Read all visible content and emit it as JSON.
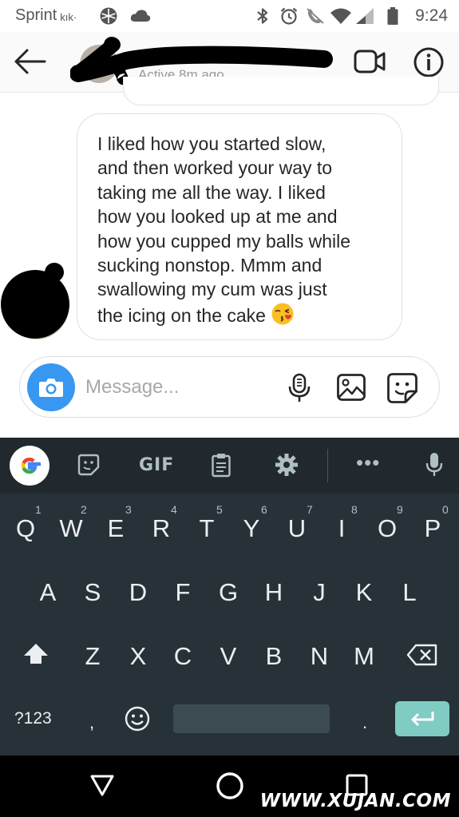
{
  "status_bar": {
    "carrier": "Sprint",
    "kik_label": "kık·",
    "time": "9:24",
    "icons": [
      "ball-icon",
      "cloud-icon",
      "bluetooth-icon",
      "alarm-icon",
      "call-muted-icon",
      "wifi-icon",
      "signal-icon",
      "battery-icon"
    ]
  },
  "header": {
    "active_status": "Active 8m ago",
    "icons": [
      "back-arrow-icon",
      "video-call-icon",
      "info-icon"
    ]
  },
  "message": {
    "text": "I liked how you started slow,\nand then worked your way to\ntaking me all the way. I liked\nhow you looked up at me and\nhow you cupped my balls while\nsucking nonstop. Mmm and\nswallowing my cum was just\nthe icing on the cake",
    "emoji": "kissing-face-emoji"
  },
  "composer": {
    "placeholder": "Message...",
    "value": "",
    "icons": [
      "camera-icon",
      "microphone-icon",
      "gallery-icon",
      "sticker-icon"
    ]
  },
  "keyboard": {
    "toolbar": {
      "gif_label": "GIF",
      "more_label": "•••",
      "icons": [
        "google-icon",
        "emoji-sticker-icon",
        "clipboard-icon",
        "settings-gear-icon",
        "voice-input-icon"
      ]
    },
    "row1": [
      {
        "letter": "Q",
        "hint": "1"
      },
      {
        "letter": "W",
        "hint": "2"
      },
      {
        "letter": "E",
        "hint": "3"
      },
      {
        "letter": "R",
        "hint": "4"
      },
      {
        "letter": "T",
        "hint": "5"
      },
      {
        "letter": "Y",
        "hint": "6"
      },
      {
        "letter": "U",
        "hint": "7"
      },
      {
        "letter": "I",
        "hint": "8"
      },
      {
        "letter": "O",
        "hint": "9"
      },
      {
        "letter": "P",
        "hint": "0"
      }
    ],
    "row2": [
      "A",
      "S",
      "D",
      "F",
      "G",
      "H",
      "J",
      "K",
      "L"
    ],
    "row3": [
      "Z",
      "X",
      "C",
      "V",
      "B",
      "N",
      "M"
    ],
    "bottom": {
      "symbols_label": "?123",
      "comma": ",",
      "period": "."
    }
  },
  "navbar": {
    "icons": [
      "back-triangle-icon",
      "home-circle-icon",
      "recents-square-icon"
    ]
  },
  "watermark": "WWW.XUJAN.COM",
  "colors": {
    "accent": "#3897f0",
    "keyboard_bg": "#263238",
    "enter_key": "#80cbc4"
  }
}
